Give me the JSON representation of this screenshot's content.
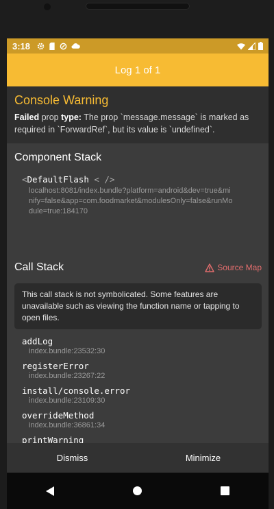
{
  "status_bar": {
    "time": "3:18"
  },
  "title": "Log 1 of 1",
  "warning": {
    "heading": "Console Warning",
    "prefix_bold": "Failed",
    "prefix_mid": " prop ",
    "prefix_bold2": "type:",
    "message": " The prop `message.message` is marked as required in `ForwardRef`, but its value is `undefined`."
  },
  "component_stack": {
    "heading": "Component Stack",
    "open": "<",
    "name": "DefaultFlash",
    "close": "< />",
    "location": "localhost:8081/index.bundle?platform=android&dev=true&minify=false&app=com.foodmarket&modulesOnly=false&runModule=true:184170"
  },
  "call_stack": {
    "heading": "Call Stack",
    "source_map_label": "Source Map",
    "notice": "This call stack is not symbolicated. Some features are unavailable such as viewing the function name or tapping to open files.",
    "frames": [
      {
        "fn": "addLog",
        "loc": "index.bundle:23532:30"
      },
      {
        "fn": "registerError",
        "loc": "index.bundle:23267:22"
      },
      {
        "fn": "install/console.error",
        "loc": "index.bundle:23109:30"
      },
      {
        "fn": "overrideMethod",
        "loc": "index.bundle:36861:34"
      },
      {
        "fn": "printWarning",
        "loc": ""
      }
    ]
  },
  "footer": {
    "dismiss": "Dismiss",
    "minimize": "Minimize"
  },
  "colors": {
    "accent": "#f7bb33",
    "status_bar": "#cc9a27",
    "source_map": "#e26d6d"
  },
  "icons": [
    "gear-icon",
    "sd-card-icon",
    "data-saver-icon",
    "cloud-icon",
    "wifi-icon",
    "signal-icon",
    "battery-icon",
    "warning-triangle-icon",
    "back-icon",
    "home-icon",
    "recents-icon"
  ]
}
